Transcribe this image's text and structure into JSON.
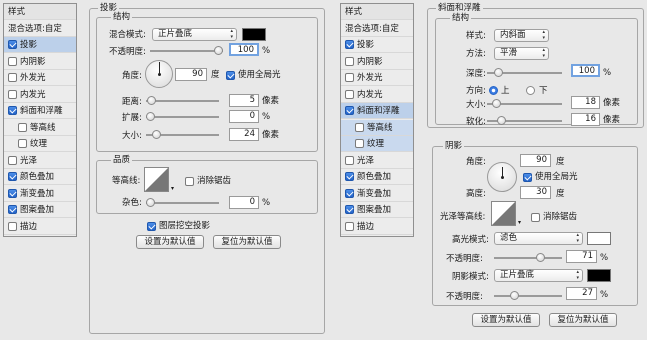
{
  "left": {
    "sidebar": {
      "items": [
        {
          "label": "样式",
          "kind": "head"
        },
        {
          "label": "混合选项:自定",
          "kind": "opt"
        },
        {
          "label": "投影",
          "checked": true,
          "sel": true
        },
        {
          "label": "内阴影",
          "checked": false
        },
        {
          "label": "外发光",
          "checked": false
        },
        {
          "label": "内发光",
          "checked": false
        },
        {
          "label": "斜面和浮雕",
          "checked": true
        },
        {
          "label": "等高线",
          "checked": false,
          "sub": true
        },
        {
          "label": "纹理",
          "checked": false,
          "sub": true
        },
        {
          "label": "光泽",
          "checked": false
        },
        {
          "label": "颜色叠加",
          "checked": true
        },
        {
          "label": "渐变叠加",
          "checked": true
        },
        {
          "label": "图案叠加",
          "checked": true
        },
        {
          "label": "描边",
          "checked": false
        }
      ]
    },
    "panel": {
      "title": "投影",
      "structure": "结构",
      "blend_label": "混合模式:",
      "blend_value": "正片叠底",
      "blend_color": "#000000",
      "opacity_label": "不透明度:",
      "opacity_value": "100",
      "opacity_pct": 1.0,
      "percent": "%",
      "angle_label": "角度:",
      "angle_value": "90",
      "angle_unit": "度",
      "global_light": "使用全局光",
      "global_light_on": true,
      "distance_label": "距离:",
      "distance_value": "5",
      "distance_pct": 0.02,
      "px": "像素",
      "spread_label": "扩展:",
      "spread_value": "0",
      "spread_pct": 0.0,
      "size_label": "大小:",
      "size_value": "24",
      "size_pct": 0.1,
      "quality": "品质",
      "contour_label": "等高线:",
      "antialias": "消除锯齿",
      "antialias_on": false,
      "noise_label": "杂色:",
      "noise_value": "0",
      "noise_pct": 0.0,
      "knockout": "图层挖空投影",
      "knockout_on": true,
      "default_btn": "设置为默认值",
      "reset_btn": "复位为默认值"
    }
  },
  "right": {
    "sidebar": {
      "items": [
        {
          "label": "样式",
          "kind": "head"
        },
        {
          "label": "混合选项:自定",
          "kind": "opt"
        },
        {
          "label": "投影",
          "checked": true
        },
        {
          "label": "内阴影",
          "checked": false
        },
        {
          "label": "外发光",
          "checked": false
        },
        {
          "label": "内发光",
          "checked": false
        },
        {
          "label": "斜面和浮雕",
          "checked": true,
          "sel": true
        },
        {
          "label": "等高线",
          "checked": false,
          "sub": true,
          "subsel": true
        },
        {
          "label": "纹理",
          "checked": false,
          "sub": true,
          "subsel": true
        },
        {
          "label": "光泽",
          "checked": false
        },
        {
          "label": "颜色叠加",
          "checked": true
        },
        {
          "label": "渐变叠加",
          "checked": true
        },
        {
          "label": "图案叠加",
          "checked": true
        },
        {
          "label": "描边",
          "checked": false
        }
      ]
    },
    "panel": {
      "title": "斜面和浮雕",
      "structure": "结构",
      "style_label": "样式:",
      "style_value": "内斜面",
      "method_label": "方法:",
      "method_value": "平滑",
      "depth_label": "深度:",
      "depth_value": "100",
      "depth_pct": 0.1,
      "percent": "%",
      "direction_label": "方向:",
      "dir_up": "上",
      "dir_down": "下",
      "dir_up_on": true,
      "size_label": "大小:",
      "size_value": "18",
      "size_pct": 0.07,
      "px": "像素",
      "soften_label": "软化:",
      "soften_value": "16",
      "soften_pct": 0.15,
      "shading": "阴影",
      "angle_label": "角度:",
      "angle_value": "90",
      "angle_unit": "度",
      "global_light": "使用全局光",
      "global_light_on": true,
      "altitude_label": "高度:",
      "altitude_value": "30",
      "gloss_label": "光泽等高线:",
      "antialias": "消除锯齿",
      "antialias_on": false,
      "highlight_label": "高光模式:",
      "highlight_value": "滤色",
      "highlight_color": "#ffffff",
      "hl_opacity_label": "不透明度:",
      "hl_opacity_value": "71",
      "hl_opacity_pct": 0.71,
      "shadow_label": "阴影模式:",
      "shadow_value": "正片叠底",
      "shadow_color": "#000000",
      "sh_opacity_label": "不透明度:",
      "sh_opacity_value": "27",
      "sh_opacity_pct": 0.27,
      "default_btn": "设置为默认值",
      "reset_btn": "复位为默认值"
    }
  }
}
